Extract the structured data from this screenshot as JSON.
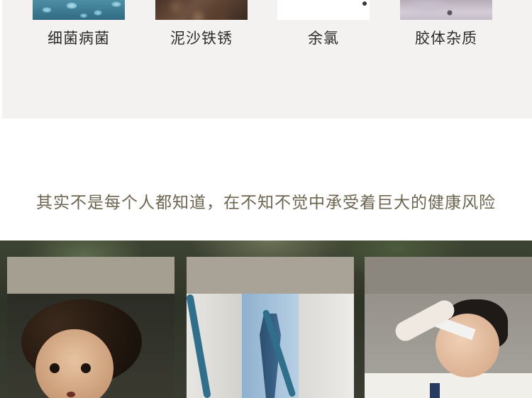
{
  "contaminants": [
    {
      "label": "细菌病菌",
      "image": "bacteria-photo"
    },
    {
      "label": "泥沙铁锈",
      "image": "rust-sediment-photo"
    },
    {
      "label": "余氯",
      "image": "chlorine-photo"
    },
    {
      "label": "胶体杂质",
      "image": "colloid-photo"
    }
  ],
  "headline": "其实不是每个人都知道，在不知不觉中承受着巨大的健康风险",
  "cards": [
    {
      "image": "child-photo"
    },
    {
      "image": "doctor-photo"
    },
    {
      "image": "headache-man-photo"
    }
  ],
  "colors": {
    "panel_bg": "#f3f2f0",
    "headline_text": "#6e6550",
    "label_text": "#2c2c2c"
  }
}
